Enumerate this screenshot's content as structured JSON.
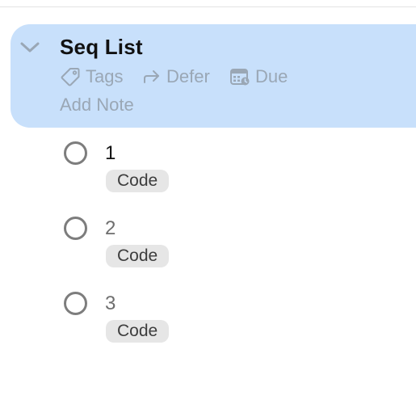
{
  "project": {
    "title": "Seq List",
    "tags_label": "Tags",
    "defer_label": "Defer",
    "due_label": "Due",
    "note_placeholder": "Add Note"
  },
  "tasks": [
    {
      "title": "1",
      "tag": "Code"
    },
    {
      "title": "2",
      "tag": "Code"
    },
    {
      "title": "3",
      "tag": "Code"
    }
  ],
  "colors": {
    "project_highlight": "#c8e0fb",
    "meta_text": "#9aa7b5",
    "tag_background": "#e6e6e6",
    "checkbox_border": "#7d7d7d"
  },
  "icons": {
    "collapse": "chevron-down-icon",
    "tags": "tag-icon",
    "defer": "arrow-right-icon",
    "due": "calendar-icon",
    "task_status": "empty-circle-icon"
  }
}
